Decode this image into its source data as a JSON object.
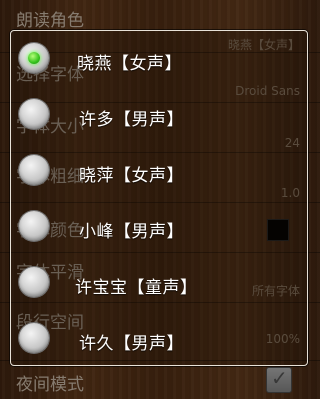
{
  "background_settings": [
    {
      "title": "朗读角色",
      "value": "晓燕【女声】"
    },
    {
      "title": "选择字体",
      "value": "Droid Sans"
    },
    {
      "title": "字体大小",
      "value": "24"
    },
    {
      "title": "字体粗细",
      "value": "1.0"
    },
    {
      "title": "字体颜色",
      "value": ""
    },
    {
      "title": "字体平滑",
      "value": "所有字体"
    },
    {
      "title": "段行空间",
      "value": "100%"
    },
    {
      "title": "夜间模式",
      "value": ""
    }
  ],
  "font_color": "#000000",
  "dialog": {
    "options": [
      {
        "label": "晓燕【女声】",
        "selected": true
      },
      {
        "label": "许多【男声】",
        "selected": false
      },
      {
        "label": "晓萍【女声】",
        "selected": false
      },
      {
        "label": "小峰【男声】",
        "selected": false
      },
      {
        "label": "许宝宝【童声】",
        "selected": false
      },
      {
        "label": "许久【男声】",
        "selected": false
      }
    ]
  }
}
